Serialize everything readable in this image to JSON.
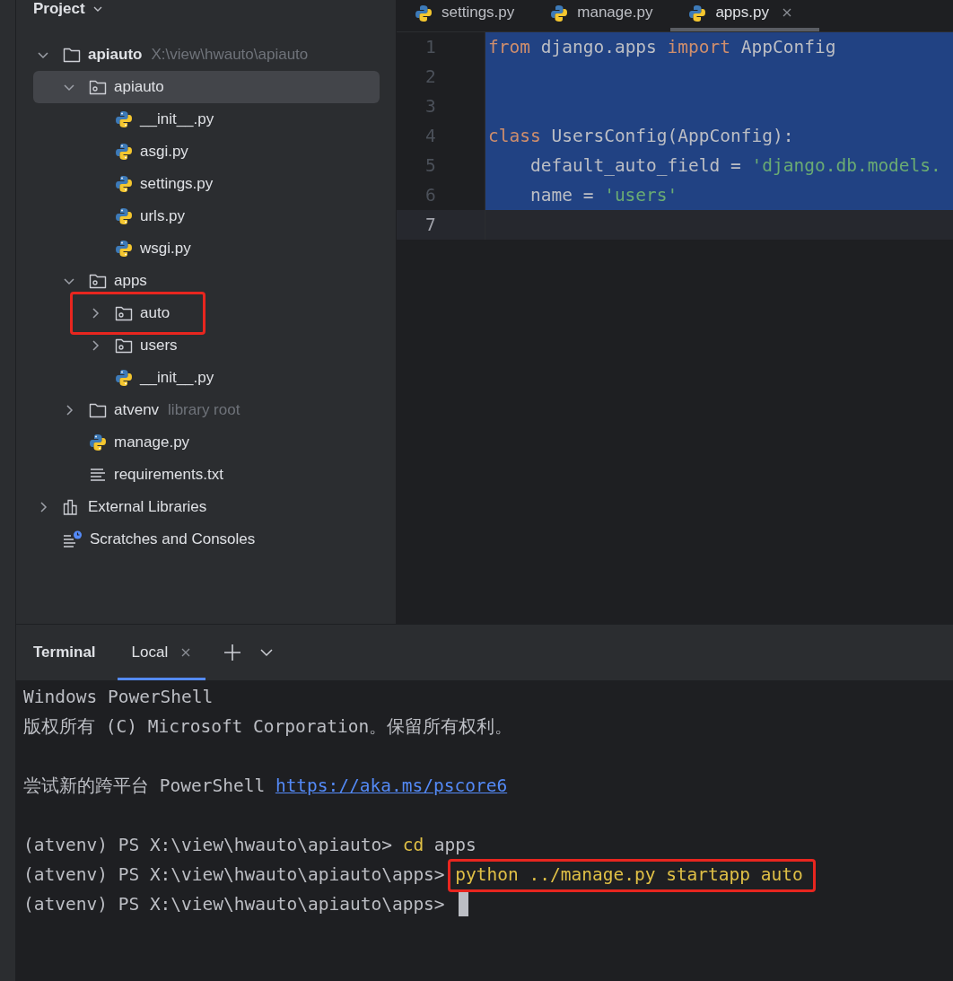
{
  "project": {
    "title": "Project",
    "tree": [
      {
        "name": "apiauto",
        "hint": "X:\\view\\hwauto\\apiauto",
        "kind": "folder",
        "bold": true,
        "expanded": true,
        "selected": false,
        "highlighted": false,
        "children": [
          {
            "name": "apiauto",
            "kind": "package",
            "expanded": true,
            "selected": true,
            "highlighted": false,
            "children": [
              {
                "name": "__init__.py",
                "kind": "python",
                "selected": false,
                "highlighted": false
              },
              {
                "name": "asgi.py",
                "kind": "python",
                "selected": false,
                "highlighted": false
              },
              {
                "name": "settings.py",
                "kind": "python",
                "selected": false,
                "highlighted": false
              },
              {
                "name": "urls.py",
                "kind": "python",
                "selected": false,
                "highlighted": false
              },
              {
                "name": "wsgi.py",
                "kind": "python",
                "selected": false,
                "highlighted": false
              }
            ]
          },
          {
            "name": "apps",
            "kind": "package",
            "expanded": true,
            "selected": false,
            "highlighted": false,
            "children": [
              {
                "name": "auto",
                "kind": "package",
                "expanded": false,
                "selected": false,
                "highlighted": true
              },
              {
                "name": "users",
                "kind": "package",
                "expanded": false,
                "selected": false,
                "highlighted": false
              },
              {
                "name": "__init__.py",
                "kind": "python",
                "selected": false,
                "highlighted": false
              }
            ]
          },
          {
            "name": "atvenv",
            "hint": "library root",
            "kind": "folder",
            "expanded": false,
            "selected": false,
            "highlighted": false
          },
          {
            "name": "manage.py",
            "kind": "python",
            "selected": false,
            "highlighted": false
          },
          {
            "name": "requirements.txt",
            "kind": "text",
            "selected": false,
            "highlighted": false
          }
        ]
      },
      {
        "name": "External Libraries",
        "kind": "libraries",
        "expanded": false,
        "selected": false,
        "highlighted": false
      },
      {
        "name": "Scratches and Consoles",
        "kind": "scratches",
        "selected": false,
        "highlighted": false
      }
    ]
  },
  "editor": {
    "tabs": [
      {
        "label": "settings.py",
        "selected": false
      },
      {
        "label": "manage.py",
        "selected": false
      },
      {
        "label": "apps.py",
        "selected": true,
        "closable": true
      }
    ],
    "lines": [
      {
        "number": "1",
        "selected": true,
        "current": false,
        "tokens": [
          {
            "text": "from",
            "kind": "keyword"
          },
          {
            "text": " django.apps ",
            "kind": "plain"
          },
          {
            "text": "import",
            "kind": "keyword"
          },
          {
            "text": " AppConfig",
            "kind": "plain"
          }
        ]
      },
      {
        "number": "2",
        "selected": true,
        "current": false
      },
      {
        "number": "3",
        "selected": true,
        "current": false
      },
      {
        "number": "4",
        "selected": true,
        "current": false,
        "tokens": [
          {
            "text": "class",
            "kind": "keyword"
          },
          {
            "text": " UsersConfig(AppConfig):",
            "kind": "plain"
          }
        ]
      },
      {
        "number": "5",
        "selected": true,
        "current": false,
        "tokens": [
          {
            "text": "    default_auto_field = ",
            "kind": "plain"
          },
          {
            "text": "'django.db.models.",
            "kind": "string"
          }
        ]
      },
      {
        "number": "6",
        "selected": true,
        "current": false,
        "tokens": [
          {
            "text": "    name = ",
            "kind": "plain"
          },
          {
            "text": "'users'",
            "kind": "string"
          }
        ]
      },
      {
        "number": "7",
        "selected": false,
        "current": true
      }
    ]
  },
  "terminal": {
    "title": "Terminal",
    "tabs": [
      {
        "label": "Local",
        "selected": true,
        "closable": true
      }
    ],
    "lines": [
      {
        "kind": "text",
        "segments": [
          {
            "text": "Windows PowerShell",
            "kind": "plain"
          }
        ]
      },
      {
        "kind": "text",
        "segments": [
          {
            "text": "版权所有 (C) Microsoft Corporation。保留所有权利。",
            "kind": "plain"
          }
        ]
      },
      {
        "kind": "blank"
      },
      {
        "kind": "text",
        "segments": [
          {
            "text": "尝试新的跨平台 PowerShell ",
            "kind": "plain"
          },
          {
            "text": "https://aka.ms/pscore6",
            "kind": "link"
          }
        ]
      },
      {
        "kind": "blank"
      },
      {
        "kind": "text",
        "segments": [
          {
            "text": "(atvenv) PS X:\\view\\hwauto\\apiauto> ",
            "kind": "plain"
          },
          {
            "text": "cd",
            "kind": "command"
          },
          {
            "text": " apps",
            "kind": "plain"
          }
        ]
      },
      {
        "kind": "text",
        "segments": [
          {
            "text": "(atvenv) PS X:\\view\\hwauto\\apiauto\\apps> ",
            "kind": "plain"
          },
          {
            "text": "python ../manage.py startapp auto",
            "kind": "input",
            "highlighted": true
          }
        ]
      },
      {
        "kind": "text",
        "cursor": true,
        "segments": [
          {
            "text": "(atvenv) PS X:\\view\\hwauto\\apiauto\\apps> ",
            "kind": "plain"
          }
        ]
      }
    ]
  }
}
